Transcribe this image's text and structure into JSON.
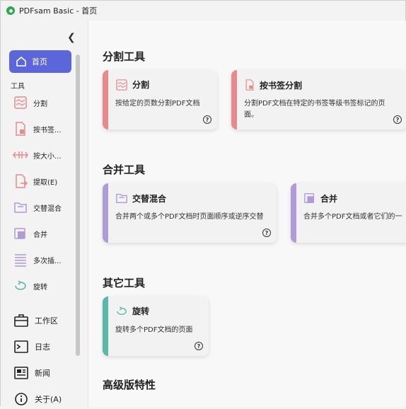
{
  "window": {
    "title": "PDFsam Basic - 首页"
  },
  "sidebar": {
    "home_label": "首页",
    "tools_label": "工具",
    "items": [
      {
        "label": "分割",
        "icon": "split-icon"
      },
      {
        "label": "按书签...",
        "icon": "bookmark-split-icon"
      },
      {
        "label": "按大小...",
        "icon": "size-split-icon"
      },
      {
        "label": "提取(E)",
        "icon": "extract-icon"
      },
      {
        "label": "交替混合",
        "icon": "alternate-mix-icon"
      },
      {
        "label": "合并",
        "icon": "merge-icon"
      },
      {
        "label": "多次插...",
        "icon": "multi-insert-icon"
      },
      {
        "label": "旋转",
        "icon": "rotate-icon"
      }
    ],
    "bottom_items": [
      {
        "label": "工作区",
        "icon": "briefcase-icon"
      },
      {
        "label": "日志",
        "icon": "log-icon"
      },
      {
        "label": "新闻",
        "icon": "news-icon"
      },
      {
        "label": "关于(A)",
        "icon": "info-icon"
      }
    ]
  },
  "main": {
    "sections": [
      {
        "title": "分割工具",
        "cards": [
          {
            "title": "分割",
            "desc": "按给定的页数分割PDF文档",
            "color": "#e88a8a"
          },
          {
            "title": "按书签分割",
            "desc": "分割PDF文档在特定的书签等级书签标记的页面。",
            "color": "#e88a8a"
          }
        ]
      },
      {
        "title": "合并工具",
        "cards": [
          {
            "title": "交替混合",
            "desc": "合并两个或多个PDF文档时页面顺序或逆序交替",
            "color": "#b09ad8"
          },
          {
            "title": "合并",
            "desc": "合并多个PDF文档或者它们的一",
            "color": "#b09ad8"
          }
        ]
      },
      {
        "title": "其它工具",
        "cards": [
          {
            "title": "旋转",
            "desc": "旋转多个PDF文档的页面",
            "color": "#5bb8a8"
          }
        ]
      },
      {
        "title": "高级版特性",
        "cards": []
      }
    ]
  },
  "colors": {
    "accent": "#5b67d8",
    "split": "#e88a8a",
    "merge": "#b09ad8",
    "other": "#5bb8a8"
  }
}
